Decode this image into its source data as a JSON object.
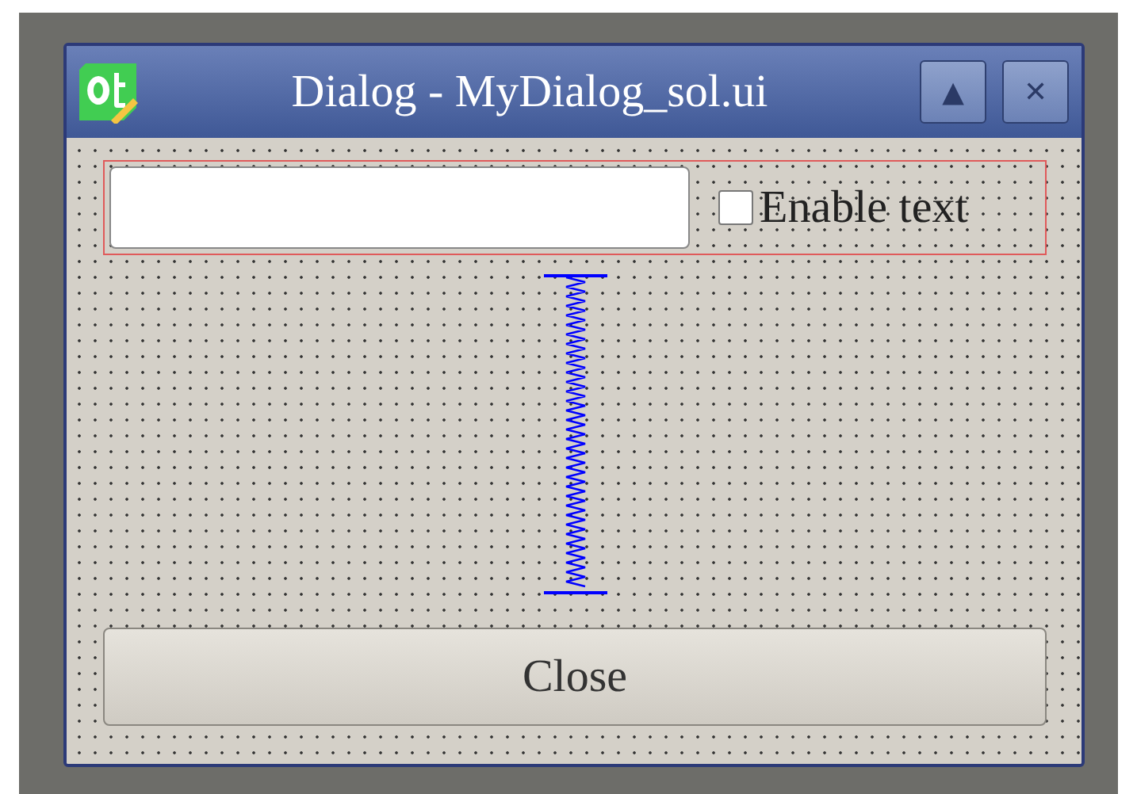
{
  "window": {
    "title": "Dialog - MyDialog_sol.ui",
    "title_buttons": [
      "▲",
      "✕"
    ]
  },
  "form": {
    "checkbox": {
      "label": "Enable text",
      "checked": false
    },
    "button": "Close"
  }
}
